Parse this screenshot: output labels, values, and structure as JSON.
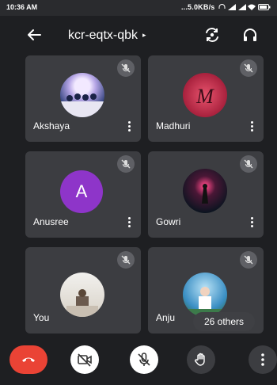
{
  "status_bar": {
    "time": "10:36 AM",
    "indicators": "...5.0KB/s"
  },
  "header": {
    "meeting_code": "kcr-eqtx-qbk",
    "caret": "▸"
  },
  "participants": [
    {
      "name": "Akshaya",
      "avatar_type": "photo",
      "muted": true
    },
    {
      "name": "Madhuri",
      "avatar_type": "photo",
      "muted": true
    },
    {
      "name": "Anusree",
      "avatar_type": "letter",
      "initial": "A",
      "avatar_color": "#8e35c9",
      "muted": true
    },
    {
      "name": "Gowri",
      "avatar_type": "photo",
      "muted": true
    },
    {
      "name": "You",
      "avatar_type": "photo",
      "muted": true
    },
    {
      "name": "Anju",
      "avatar_type": "photo",
      "muted": true
    }
  ],
  "others_badge": "26 others",
  "controls": {
    "icons": [
      "end-call-icon",
      "camera-off-icon",
      "mic-off-icon",
      "raise-hand-icon",
      "more-options-icon"
    ]
  },
  "colors": {
    "background": "#1e1f22",
    "tile": "#3c3d41",
    "end_call": "#ea4335",
    "avatar_purple": "#8e35c9"
  }
}
